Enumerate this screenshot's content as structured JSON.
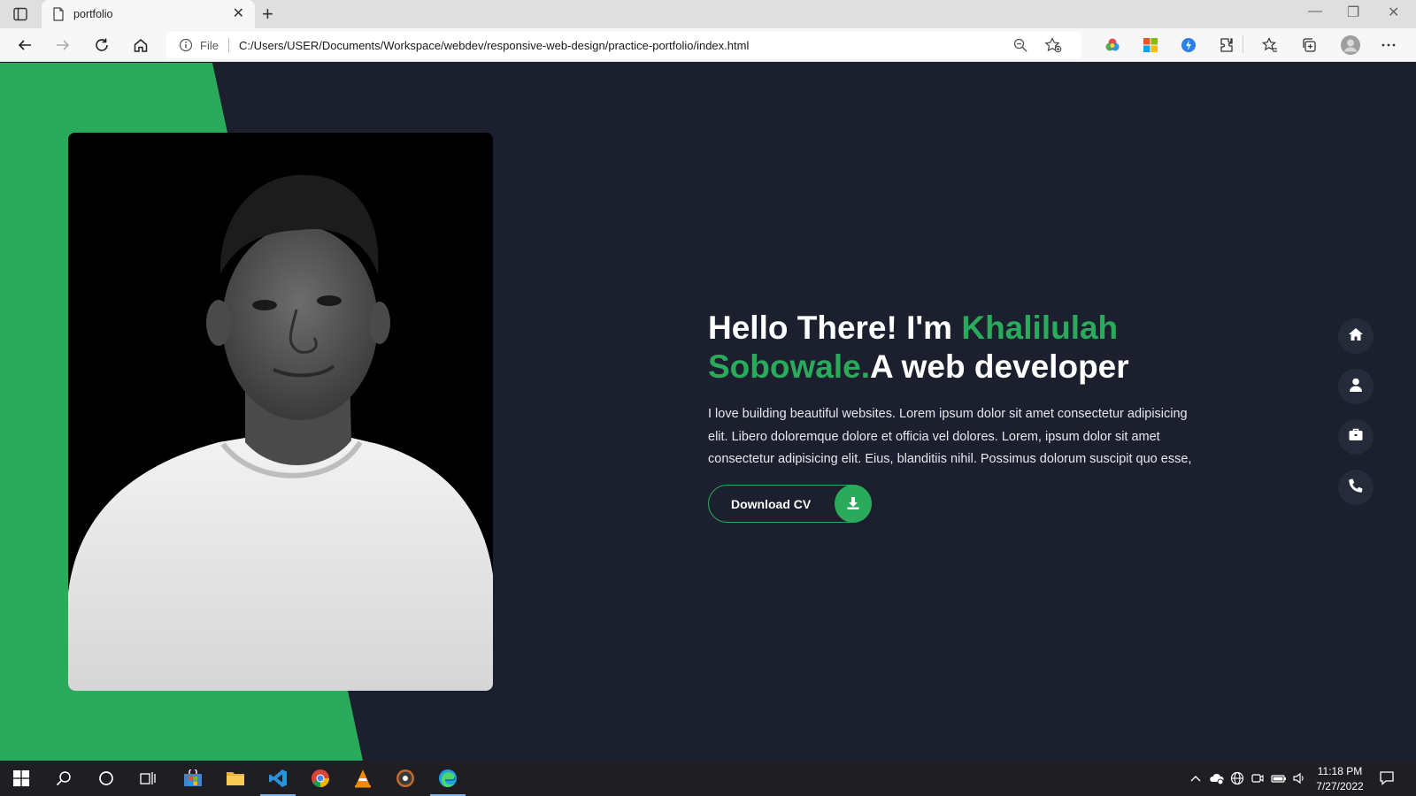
{
  "browser": {
    "tab_title": "portfolio",
    "address_label": "File",
    "url": "C:/Users/USER/Documents/Workspace/webdev/responsive-web-design/practice-portfolio/index.html"
  },
  "hero": {
    "greeting": "Hello There! I'm ",
    "name": "Khalilulah Sobowale.",
    "role": "A web developer",
    "description": "I love building beautiful websites. Lorem ipsum dolor sit amet consectetur adipisicing elit. Libero doloremque dolore et officia vel dolores. Lorem, ipsum dolor sit amet consectetur adipisicing elit. Eius, blanditiis nihil. Possimus dolorum suscipit quo esse,",
    "cta_label": "Download CV"
  },
  "side_nav": [
    {
      "name": "home-icon"
    },
    {
      "name": "user-icon"
    },
    {
      "name": "briefcase-icon"
    },
    {
      "name": "phone-icon"
    }
  ],
  "colors": {
    "accent": "#2aaa5b",
    "background": "#1b1f2e",
    "nav_button": "#262b3b"
  },
  "taskbar": {
    "time": "11:18 PM",
    "date": "7/27/2022"
  }
}
